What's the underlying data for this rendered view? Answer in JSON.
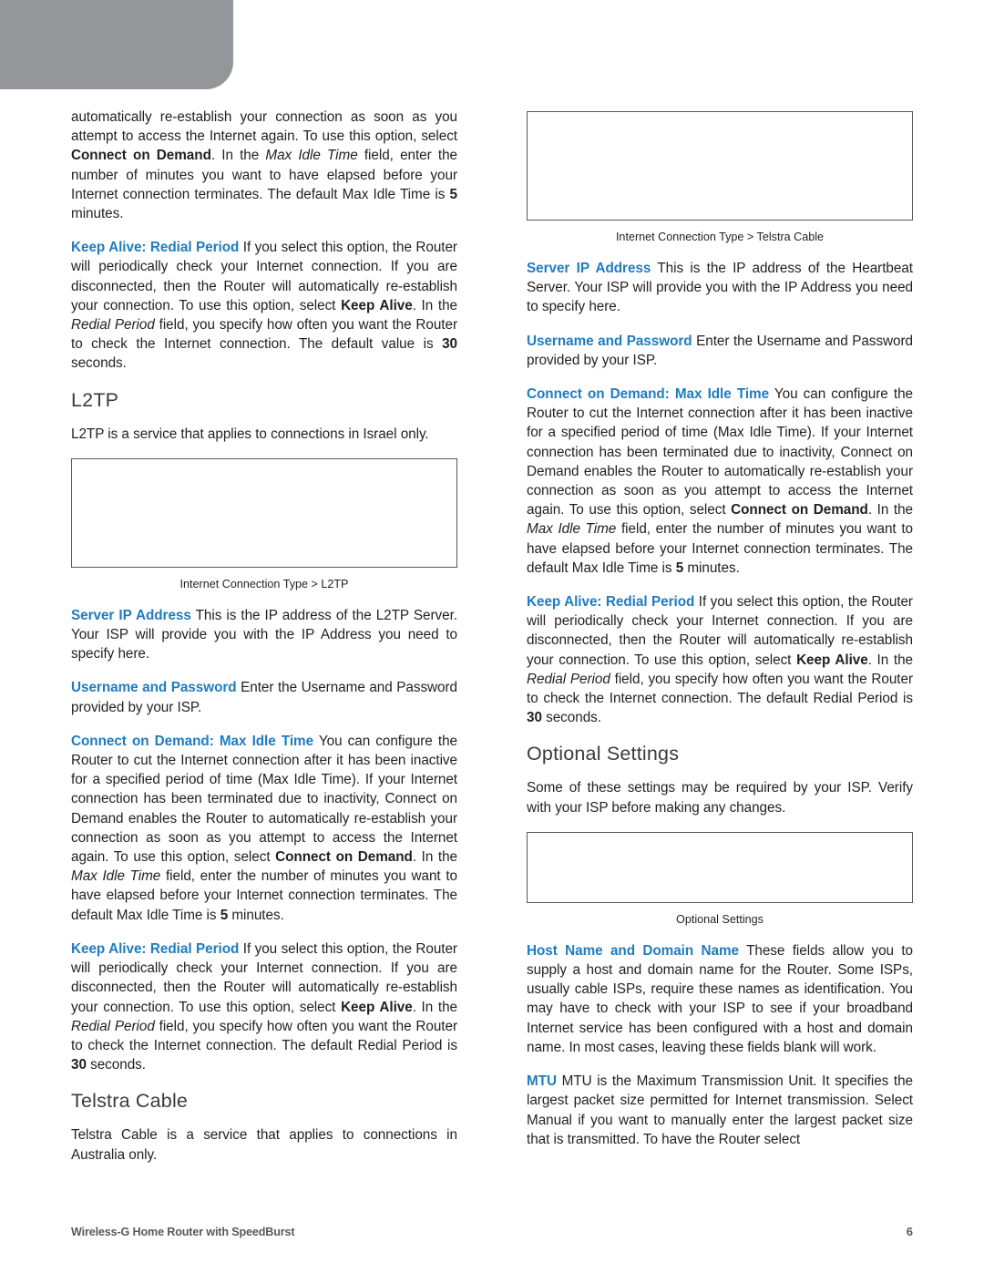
{
  "document": {
    "footer_title": "Wireless-G Home Router with SpeedBurst",
    "page_number": "6"
  },
  "colors": {
    "accent_blue": "#1F7CC0",
    "header_block_gray": "#949699",
    "body_text": "#231F20",
    "figure_border": "#58595B"
  },
  "left_column": {
    "para_continued": {
      "text_1": "automatically re-establish your connection as soon as you attempt to access the Internet again. To use this option, select ",
      "bold_1": "Connect on Demand",
      "text_2": ". In the ",
      "italic_1": "Max Idle Time",
      "text_3": " field, enter the number of minutes you want to have elapsed before your Internet connection terminates. The default Max Idle Time is ",
      "bold_2": "5",
      "text_4": " minutes."
    },
    "keep_alive": {
      "heading": "Keep Alive: Redial Period",
      "text_1": " If you select this option, the Router will periodically check your Internet connection. If you are disconnected, then the Router will automatically re-establish your connection. To use this option, select ",
      "bold_1": "Keep Alive",
      "text_2": ". In the ",
      "italic_1": "Redial Period",
      "text_3": " field, you specify how often you want the Router to check the Internet connection. The default value is ",
      "bold_2": "30",
      "text_4": " seconds."
    },
    "l2tp_heading": "L2TP",
    "l2tp_intro": "L2TP is a service that applies to connections in Israel only.",
    "l2tp_figure_caption": "Internet Connection Type > L2TP",
    "server_ip": {
      "heading": "Server IP Address",
      "text": " This is the IP address of the L2TP Server. Your ISP will provide you with the IP Address you need to specify here."
    },
    "username_password": {
      "heading": "Username and Password",
      "text": " Enter the Username and Password provided by your ISP."
    },
    "connect_on_demand": {
      "heading": "Connect on Demand: Max Idle Time",
      "text_1": "  You can configure the Router to cut the Internet connection after it has been inactive for a specified period of time (Max Idle Time). If your Internet connection has been terminated due to inactivity, Connect on Demand enables the Router to automatically re-establish your connection as soon as you attempt to access the Internet again. To use this option, select ",
      "bold_1": "Connect on Demand",
      "text_2": ". In the ",
      "italic_1": "Max Idle Time",
      "text_3": " field, enter the number of minutes you want to have elapsed before your Internet connection terminates. The default Max Idle Time is ",
      "bold_2": "5",
      "text_4": " minutes."
    },
    "keep_alive_2": {
      "heading": "Keep Alive: Redial Period",
      "text_1": " If you select this option, the Router will periodically check your Internet connection. If you are disconnected, then the Router will automatically re-establish your connection. To use this option, select ",
      "bold_1": "Keep Alive",
      "text_2": ". In the ",
      "italic_1": "Redial Period",
      "text_3": " field, you specify how often you want the Router to check the Internet connection. The default Redial Period is ",
      "bold_2": "30",
      "text_4": " seconds."
    },
    "telstra_heading": "Telstra Cable",
    "telstra_intro": "Telstra Cable is a service that applies to connections in Australia only."
  },
  "right_column": {
    "telstra_figure_caption": "Internet Connection Type > Telstra Cable",
    "server_ip": {
      "heading": "Server IP Address",
      "text": "  This is the IP address of the Heartbeat Server. Your ISP will provide you with the IP Address you need to specify here."
    },
    "username_password": {
      "heading": "Username and Password",
      "text": " Enter the Username and Password provided by your ISP."
    },
    "connect_on_demand": {
      "heading": "Connect on Demand: Max Idle Time",
      "text_1": "  You can configure the Router to cut the Internet connection after it has been inactive for a specified period of time (Max Idle Time). If your Internet connection has been terminated due to inactivity, Connect on Demand enables the Router to automatically re-establish your connection as soon as you attempt to access the Internet again. To use this option, select ",
      "bold_1": "Connect on Demand",
      "text_2": ". In the ",
      "italic_1": "Max Idle Time",
      "text_3": " field, enter the number of minutes you want to have elapsed before your Internet connection terminates. The default Max Idle Time is ",
      "bold_2": "5",
      "text_4": " minutes."
    },
    "keep_alive": {
      "heading": "Keep Alive: Redial Period",
      "text_1": " If you select this option, the Router will periodically check your Internet connection. If you are disconnected, then the Router will automatically re-establish your connection. To use this option, select ",
      "bold_1": "Keep Alive",
      "text_2": ". In the ",
      "italic_1": "Redial Period",
      "text_3": " field, you specify how often you want the Router to check the Internet connection. The default Redial Period is ",
      "bold_2": "30",
      "text_4": " seconds."
    },
    "optional_heading": "Optional Settings",
    "optional_intro": "Some of these settings may be required by your ISP. Verify with your ISP before making any changes.",
    "optional_figure_caption": "Optional Settings",
    "host_domain": {
      "heading": "Host Name and Domain Name",
      "text": "  These fields allow you to supply a host and domain name for the Router. Some ISPs, usually cable ISPs, require these names as identification. You may have to check with your ISP to see if your broadband Internet service has been configured with a host and domain name. In most cases, leaving these fields blank will work."
    },
    "mtu": {
      "heading": "MTU",
      "text": "  MTU is the Maximum Transmission Unit. It specifies the largest packet size permitted for Internet transmission. Select Manual if you want to manually enter the largest packet size that is transmitted. To have the Router select"
    }
  }
}
